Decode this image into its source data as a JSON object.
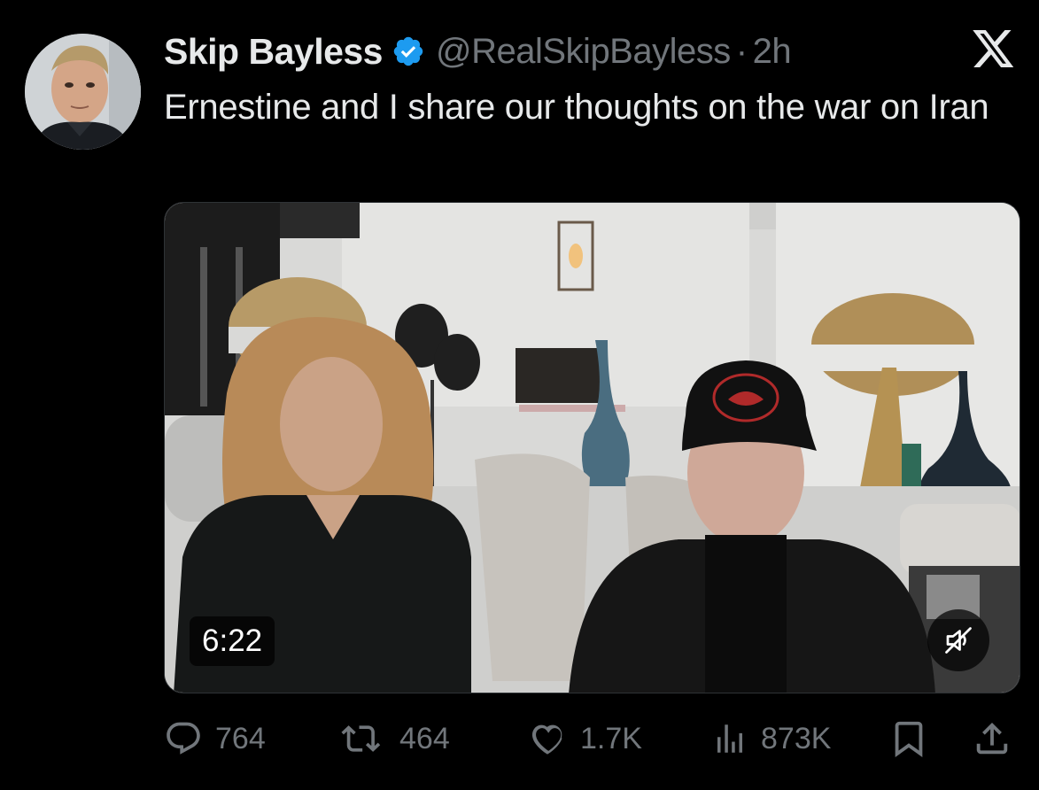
{
  "tweet": {
    "display_name": "Skip Bayless",
    "handle": "@RealSkipBayless",
    "separator": "·",
    "time": "2h",
    "text": "Ernestine and I share our thoughts on the war on Iran"
  },
  "media": {
    "duration": "6:22"
  },
  "actions": {
    "replies": "764",
    "reposts": "464",
    "likes": "1.7K",
    "views": "873K"
  },
  "colors": {
    "background": "#000000",
    "text": "#e7e9ea",
    "muted": "#71767b",
    "verified": "#1d9bf0"
  },
  "icons": [
    "x-logo-icon",
    "verified-badge-icon",
    "mute-icon",
    "reply-icon",
    "repost-icon",
    "like-icon",
    "views-icon",
    "bookmark-icon",
    "share-icon"
  ]
}
